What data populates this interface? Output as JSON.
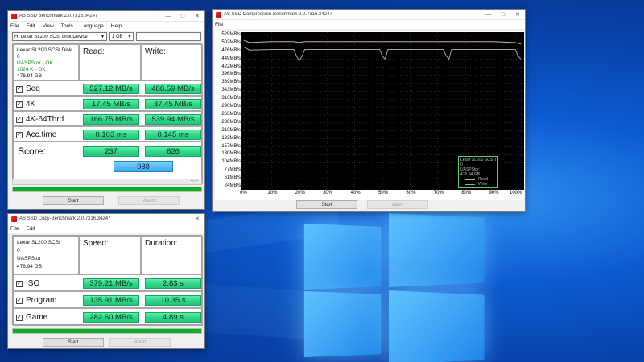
{
  "desktop": {},
  "bench": {
    "title": "AS SSD Benchmark 2.0.7316.34247",
    "menu": [
      "File",
      "Edit",
      "View",
      "Tools",
      "Language",
      "Help"
    ],
    "drive_select": "H: Lexar SL200 SCSI Disk Device",
    "size_select": "1 GB",
    "info": [
      "Lexar SL200 SCSI Disk",
      "0",
      "UASPStor - OK",
      "1024 K - OK",
      "476.94 GB"
    ],
    "read_header": "Read:",
    "write_header": "Write:",
    "rows": [
      {
        "label": "Seq",
        "read": "527.12 MB/s",
        "write": "488.59 MB/s"
      },
      {
        "label": "4K",
        "read": "17.45 MB/s",
        "write": "37.45 MB/s"
      },
      {
        "label": "4K-64Thrd",
        "read": "166.75 MB/s",
        "write": "539.94 MB/s"
      },
      {
        "label": "Acc.time",
        "read": "0.103 ms",
        "write": "0.145 ms"
      }
    ],
    "score_label": "Score:",
    "score_read": "237",
    "score_write": "626",
    "score_total": "988",
    "time_text": "--:--",
    "progress": 1.0,
    "start": "Start",
    "abort": "Abort"
  },
  "copy": {
    "title": "AS SSD Copy-Benchmark 2.0.7316.34247",
    "menu": [
      "File",
      "Edit"
    ],
    "info": [
      "Lexar SL200 SCSI",
      "0",
      "UASPStor",
      "476.94 GB"
    ],
    "speed_header": "Speed:",
    "duration_header": "Duration:",
    "rows": [
      {
        "label": "ISO",
        "speed": "379.21 MB/s",
        "duration": "2.83 s"
      },
      {
        "label": "Program",
        "speed": "135.91 MB/s",
        "duration": "10.35 s"
      },
      {
        "label": "Game",
        "speed": "282.60 MB/s",
        "duration": "4.89 s"
      }
    ],
    "progress": 1.0,
    "start": "Start",
    "abort": "Abort"
  },
  "comp": {
    "title": "AS SSD Compression-Benchmark 2.0.7316.34247",
    "menu": [
      "File"
    ],
    "legend_lines": [
      "Lexar SL200 SCSI Dis",
      "0",
      "UASPStor",
      "476.94 GB"
    ],
    "legend_read": "Read",
    "legend_write": "Write",
    "start": "Start",
    "abort": "Abort",
    "colors": {
      "read": "#c8b98c",
      "write": "#a4a4a4"
    }
  },
  "chart_data": {
    "type": "line",
    "y_ticks": [
      "529MB/s",
      "502MB/s",
      "476MB/s",
      "449MB/s",
      "422MB/s",
      "396MB/s",
      "369MB/s",
      "343MB/s",
      "316MB/s",
      "290MB/s",
      "263MB/s",
      "236MB/s",
      "210MB/s",
      "183MB/s",
      "157MB/s",
      "130MB/s",
      "104MB/s",
      "77MB/s",
      "51MB/s",
      "24MB/s"
    ],
    "x_ticks": [
      "0%",
      "10%",
      "20%",
      "30%",
      "40%",
      "50%",
      "60%",
      "70%",
      "80%",
      "90%",
      "100%"
    ],
    "ylim": [
      24,
      529
    ],
    "series": [
      {
        "name": "Read",
        "x": [
          0,
          2,
          10,
          18,
          20,
          22,
          30,
          40,
          50,
          60,
          70,
          80,
          90,
          98,
          100
        ],
        "y": [
          512,
          505,
          508,
          508,
          505,
          508,
          508,
          508,
          508,
          508,
          508,
          508,
          508,
          505,
          500
        ]
      },
      {
        "name": "Write",
        "x": [
          0,
          2,
          10,
          18,
          19,
          20,
          21,
          22,
          30,
          40,
          49,
          50,
          51,
          52,
          60,
          70,
          72,
          73,
          74,
          75,
          80,
          90,
          98,
          99,
          100
        ],
        "y": [
          490,
          480,
          482,
          482,
          460,
          445,
          460,
          482,
          482,
          482,
          482,
          460,
          450,
          482,
          482,
          482,
          482,
          462,
          450,
          482,
          482,
          482,
          482,
          460,
          450
        ]
      }
    ]
  }
}
